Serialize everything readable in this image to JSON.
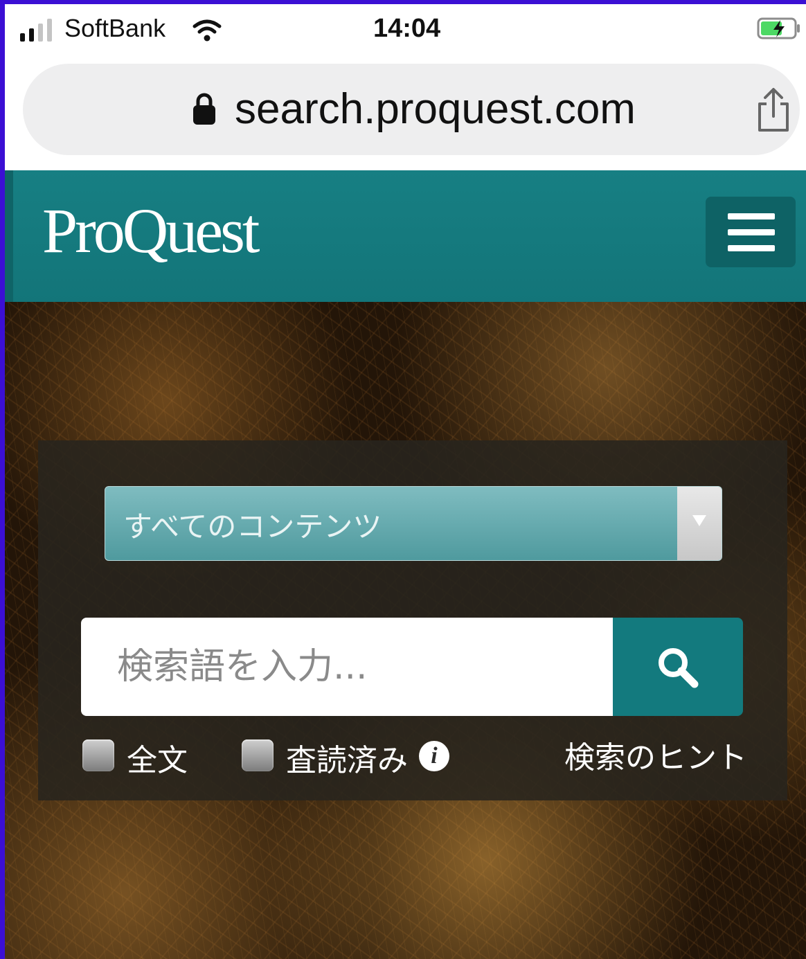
{
  "status_bar": {
    "carrier": "SoftBank",
    "time": "14:04",
    "signal_bars_active": 2,
    "signal_bars_total": 4,
    "battery_state": "charging"
  },
  "browser": {
    "url": "search.proquest.com",
    "icons": [
      "lock-icon",
      "share-icon"
    ]
  },
  "header": {
    "logo_text": "ProQuest",
    "menu_icon": "hamburger-menu-icon",
    "brand_color": "#177f83"
  },
  "search": {
    "source_select": {
      "selected": "すべてのコンテンツ"
    },
    "query_input": {
      "value": "",
      "placeholder": "検索語を入力..."
    },
    "search_icon": "magnifier-icon",
    "options": [
      {
        "label": "全文",
        "checked": false
      },
      {
        "label": "査読済み",
        "checked": false
      }
    ],
    "info_icon": "info-icon",
    "tips_link": "検索のヒント"
  }
}
